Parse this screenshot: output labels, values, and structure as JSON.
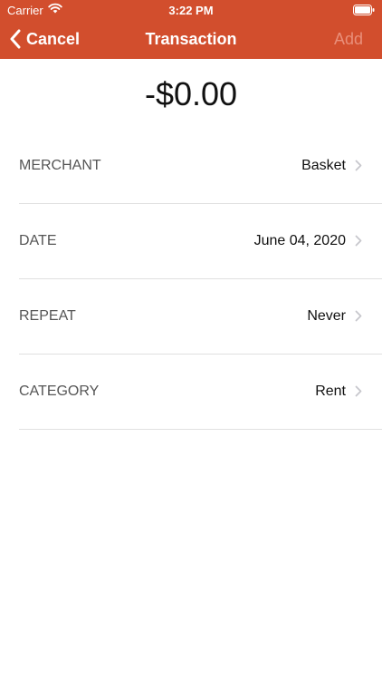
{
  "status_bar": {
    "carrier": "Carrier",
    "time": "3:22 PM"
  },
  "nav": {
    "cancel_label": "Cancel",
    "title": "Transaction",
    "add_label": "Add"
  },
  "amount": "-$0.00",
  "rows": [
    {
      "label": "MERCHANT",
      "value": "Basket"
    },
    {
      "label": "DATE",
      "value": "June 04, 2020"
    },
    {
      "label": "REPEAT",
      "value": "Never"
    },
    {
      "label": "CATEGORY",
      "value": "Rent"
    }
  ],
  "colors": {
    "header": "#D24E2D",
    "add_disabled": "#E98F7A",
    "separator": "#e0e0e0",
    "chevron": "#c7c7cc"
  },
  "icons": [
    "wifi-icon",
    "battery-icon",
    "back-chevron-icon",
    "chevron-right-icon"
  ]
}
